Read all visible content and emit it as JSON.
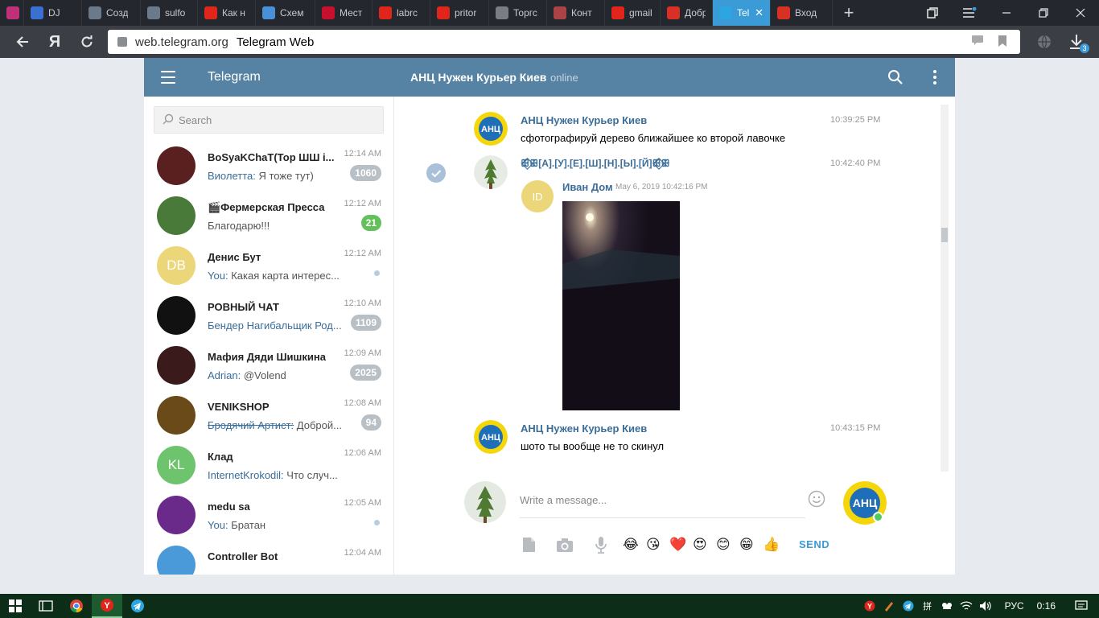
{
  "browser": {
    "tabs": [
      {
        "title": "",
        "favicon": "feather-icon",
        "color": "#c0307a"
      },
      {
        "title": "DJ",
        "favicon": "play-icon",
        "color": "#3b6fd1"
      },
      {
        "title": "Созд",
        "favicon": "car-icon",
        "color": "#6b7a8a"
      },
      {
        "title": "sulfo",
        "favicon": "car-icon",
        "color": "#6b7a8a"
      },
      {
        "title": "Как н",
        "favicon": "yandex-icon",
        "color": "#e0251b"
      },
      {
        "title": "Схем",
        "favicon": "a-icon",
        "color": "#4a90d9"
      },
      {
        "title": "Мест",
        "favicon": "n-icon",
        "color": "#c8102e"
      },
      {
        "title": "labrc",
        "favicon": "yandex-icon",
        "color": "#e0251b"
      },
      {
        "title": "pritor",
        "favicon": "yandex-icon",
        "color": "#e0251b"
      },
      {
        "title": "Торгс",
        "favicon": "page-icon",
        "color": "#7a7d82"
      },
      {
        "title": "Конт",
        "favicon": "puzzle-icon",
        "color": "#a44"
      },
      {
        "title": "gmail",
        "favicon": "yandex-icon",
        "color": "#e0251b"
      },
      {
        "title": "Добр",
        "favicon": "gmail-icon",
        "color": "#d93025"
      },
      {
        "title": "Tel",
        "favicon": "telegram-icon",
        "color": "#2ca5e0",
        "active": true
      },
      {
        "title": "Вход",
        "favicon": "gmail-icon",
        "color": "#d93025"
      }
    ],
    "url_domain": "web.telegram.org",
    "url_title": "Telegram Web",
    "download_count": "3"
  },
  "telegram": {
    "brand": "Telegram",
    "chat_title": "АНЦ Нужен Курьер Киев",
    "chat_status": "online",
    "search_placeholder": "Search",
    "dialogs": [
      {
        "name": "BoSyaKChaT(Тор ШШ i...",
        "time": "12:14 AM",
        "from": "Виолетта:",
        "text": "Я тоже тут)",
        "badge": "1060",
        "avatar_color": "#5a2020",
        "avatar_text": ""
      },
      {
        "name": "🎬Фермерская Пресса",
        "time": "12:12 AM",
        "from": "",
        "text": "Благодарю!!!",
        "badge": "21",
        "badge_green": true,
        "avatar_color": "#4a7a3a",
        "avatar_text": ""
      },
      {
        "name": "Денис Бут",
        "time": "12:12 AM",
        "from": "You:",
        "text": "Какая карта интерес...",
        "dot": true,
        "avatar_color": "#ecd67a",
        "avatar_text": "DB"
      },
      {
        "name": "РОВНЫЙ ЧАТ",
        "time": "12:10 AM",
        "from": "Бендер Нагибальщик Род...",
        "text": "",
        "badge": "1109",
        "avatar_color": "#111",
        "avatar_text": ""
      },
      {
        "name": "Мафия Дяди Шишкина",
        "time": "12:09 AM",
        "from": "Adrian:",
        "text": "@Volend",
        "badge": "2025",
        "avatar_color": "#3a1a1a",
        "avatar_text": ""
      },
      {
        "name": "VENIKSHOP",
        "time": "12:08 AM",
        "from": "Бродячий Артист:",
        "text": "Доброй...",
        "strike": true,
        "badge": "94",
        "avatar_color": "#6b4a1a",
        "avatar_text": ""
      },
      {
        "name": "Клад",
        "time": "12:06 AM",
        "from": "InternetKrokodil:",
        "text": "Что случ...",
        "avatar_color": "#6dc46d",
        "avatar_text": "KL"
      },
      {
        "name": "medu sa",
        "time": "12:05 AM",
        "from": "You:",
        "text": "Братан",
        "dot": true,
        "avatar_color": "#6a2a8a",
        "avatar_text": ""
      },
      {
        "name": "Controller Bot",
        "time": "12:04 AM",
        "from": "",
        "text": "",
        "avatar_color": "#4a9ad9",
        "avatar_text": ""
      }
    ],
    "messages": [
      {
        "author": "АНЦ Нужен Курьер Киев",
        "time": "10:39:25 PM",
        "text": "сфотографируй дерево ближайшее ко второй лавочке"
      },
      {
        "author": "ꕥ⃟ꕥ[А].[У].[Е].[Ш].[Н].[Ы].[Й]ꕥ⃟ꕥ",
        "time": "10:42:40 PM",
        "fwd_from": "Иван Дом",
        "fwd_date": "May 6, 2019 10:42:16 PM",
        "fwd_initials": "ID"
      },
      {
        "author": "АНЦ Нужен Курьер Киев",
        "time": "10:43:15 PM",
        "text": "шото ты вообще не то скинул"
      }
    ],
    "composer": {
      "placeholder": "Write a message...",
      "send_label": "SEND",
      "quick_emojis": [
        "😂",
        "😘",
        "❤️",
        "😍",
        "😊",
        "😁",
        "👍"
      ]
    }
  },
  "taskbar": {
    "lang": "РУС",
    "clock": "0:16"
  }
}
